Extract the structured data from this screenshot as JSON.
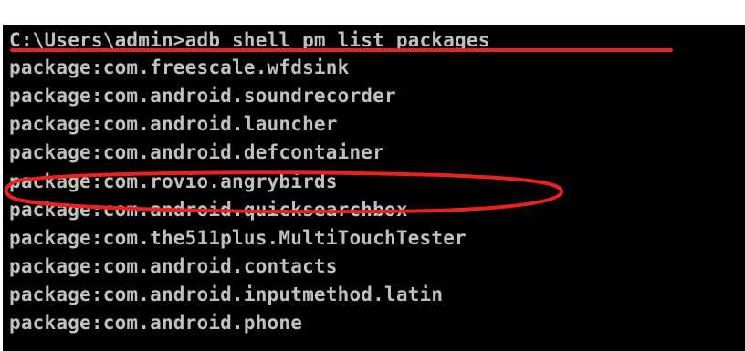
{
  "terminal": {
    "prompt_line": "C:\\Users\\admin>adb shell pm list packages",
    "output_lines": [
      "package:com.freescale.wfdsink",
      "package:com.android.soundrecorder",
      "package:com.android.launcher",
      "package:com.android.defcontainer",
      "package:com.rovio.angrybirds",
      "package:com.android.quicksearchbox",
      "package:com.the511plus.MultiTouchTester",
      "package:com.android.contacts",
      "package:com.android.inputmethod.latin",
      "package:com.android.phone"
    ]
  },
  "annotations": {
    "highlight_color": "#e8221f",
    "underline_target": "prompt_line",
    "circled_line": "package:com.rovio.angrybirds"
  },
  "colors": {
    "background": "#000000",
    "text": "#c0c0c0"
  }
}
